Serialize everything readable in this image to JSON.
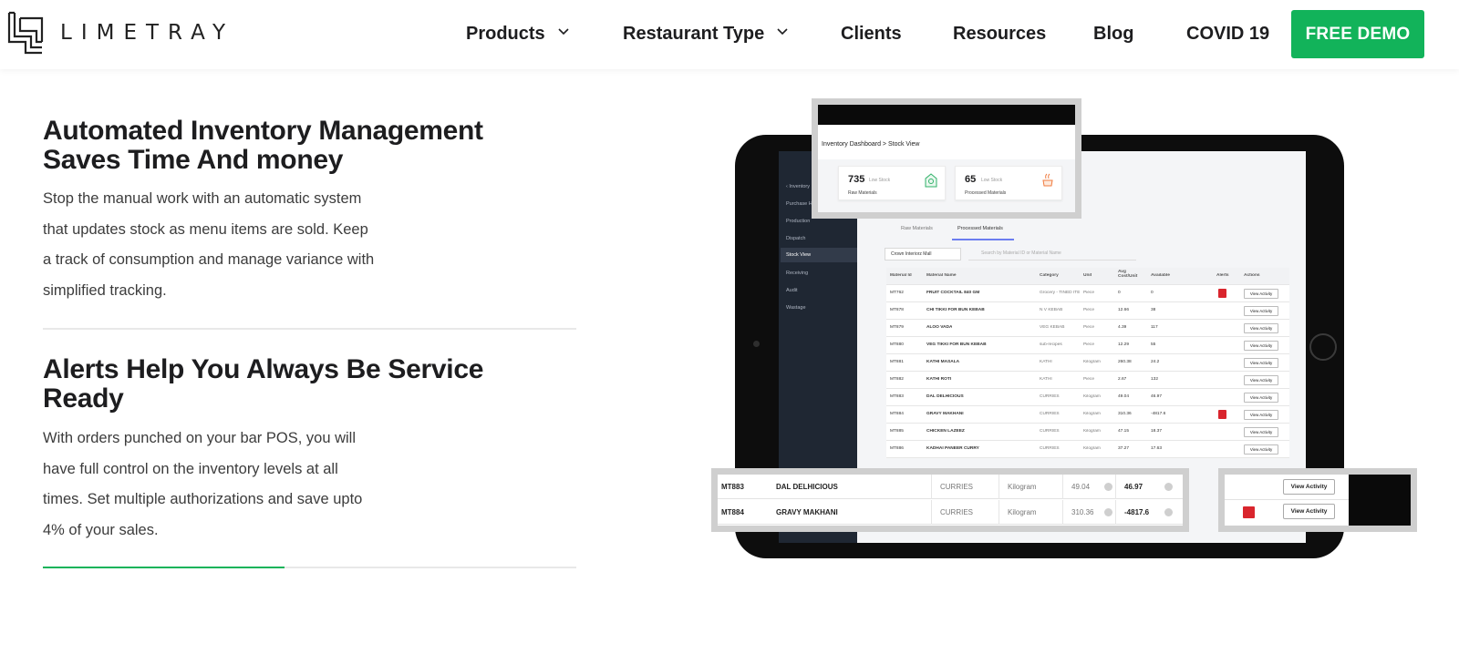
{
  "header": {
    "logo_text": "LIMETRAY",
    "nav": [
      {
        "label": "Products",
        "has_dropdown": true
      },
      {
        "label": "Restaurant Type",
        "has_dropdown": true
      },
      {
        "label": "Clients",
        "has_dropdown": false
      },
      {
        "label": "Resources",
        "has_dropdown": false
      },
      {
        "label": "Blog",
        "has_dropdown": false
      },
      {
        "label": "COVID 19",
        "has_dropdown": false
      }
    ],
    "cta_label": "FREE DEMO",
    "accent_color": "#12b35a"
  },
  "sections": [
    {
      "title_line1": "Automated Inventory Management",
      "title_line2": "Saves Time And money",
      "body_lines": [
        "Stop the manual work with an automatic system",
        "that updates stock as menu items are sold. Keep",
        "a track of consumption and manage variance with",
        "simplified tracking."
      ]
    },
    {
      "title_line1": "Alerts Help You Always Be Service",
      "title_line2": "Ready",
      "body_lines": [
        "With orders punched on your bar POS, you will",
        "have full control on the inventory levels at all",
        "times. Set multiple authorizations and save upto",
        "4% of your sales."
      ]
    }
  ],
  "mockup": {
    "breadcrumb": "Inventory Dashboard  >  Stock View",
    "stats": [
      {
        "value": "735",
        "tag": "Low Stock",
        "label": "Raw Materials"
      },
      {
        "value": "65",
        "tag": "Low Stock",
        "label": "Processed Materials"
      }
    ],
    "sidebar": [
      "Inventory",
      "Purchase Hub",
      "Production",
      "Dispatch",
      "Stock View",
      "Receiving",
      "Audit",
      "Wastage"
    ],
    "tabs": [
      "Raw Materials",
      "Processed Materials"
    ],
    "store_select": "Crown Interiorz Mall",
    "search_placeholder": "Search by Material ID or Material Name",
    "columns": [
      "Material Id",
      "Material Name",
      "Category",
      "Unit",
      "Avg Cost/Unit",
      "Available",
      "Alerts",
      "Actions"
    ],
    "rows": [
      {
        "id": "MT762",
        "name": "FRUIT COCKTAIL 840 GM",
        "category": "Grocery - TINED ITEM",
        "unit": "Piece",
        "cost": "0",
        "available": "0",
        "alert": true
      },
      {
        "id": "MT878",
        "name": "CHI TIKKI FOR BUN KEBAB",
        "category": "N V KEBAB",
        "unit": "Piece",
        "cost": "12.66",
        "available": "38",
        "alert": false
      },
      {
        "id": "MT879",
        "name": "ALOO VADA",
        "category": "VEG KEBAB",
        "unit": "Piece",
        "cost": "4.39",
        "available": "117",
        "alert": false
      },
      {
        "id": "MT880",
        "name": "VEG TIKKI FOR BUN KEBAB",
        "category": "sub-recipes",
        "unit": "Piece",
        "cost": "12.29",
        "available": "55",
        "alert": false
      },
      {
        "id": "MT881",
        "name": "KATHI MASALA",
        "category": "KATHI",
        "unit": "Kilogram",
        "cost": "260.38",
        "available": "24.2",
        "alert": false
      },
      {
        "id": "MT882",
        "name": "KATHI ROTI",
        "category": "KATHI",
        "unit": "Piece",
        "cost": "2.67",
        "available": "132",
        "alert": false
      },
      {
        "id": "MT883",
        "name": "DAL DELHICIOUS",
        "category": "CURRIES",
        "unit": "Kilogram",
        "cost": "49.04",
        "available": "46.97",
        "alert": false
      },
      {
        "id": "MT884",
        "name": "GRAVY MAKHANI",
        "category": "CURRIES",
        "unit": "Kilogram",
        "cost": "310.36",
        "available": "-4817.6",
        "alert": true
      },
      {
        "id": "MT885",
        "name": "CHICKEN LAZEEZ",
        "category": "CURRIES",
        "unit": "Kilogram",
        "cost": "47.15",
        "available": "18.37",
        "alert": false
      },
      {
        "id": "MT886",
        "name": "KADHAI PANEER CURRY",
        "category": "CURRIES",
        "unit": "Kilogram",
        "cost": "37.27",
        "available": "17.63",
        "alert": false
      }
    ],
    "action_label": "View Activity",
    "zoom_rows": [
      {
        "id": "MT883",
        "name": "DAL DELHICIOUS",
        "category": "CURRIES",
        "unit": "Kilogram",
        "cost": "49.04",
        "available": "46.97",
        "alert": false
      },
      {
        "id": "MT884",
        "name": "GRAVY MAKHANI",
        "category": "CURRIES",
        "unit": "Kilogram",
        "cost": "310.36",
        "available": "-4817.6",
        "alert": true
      }
    ]
  }
}
